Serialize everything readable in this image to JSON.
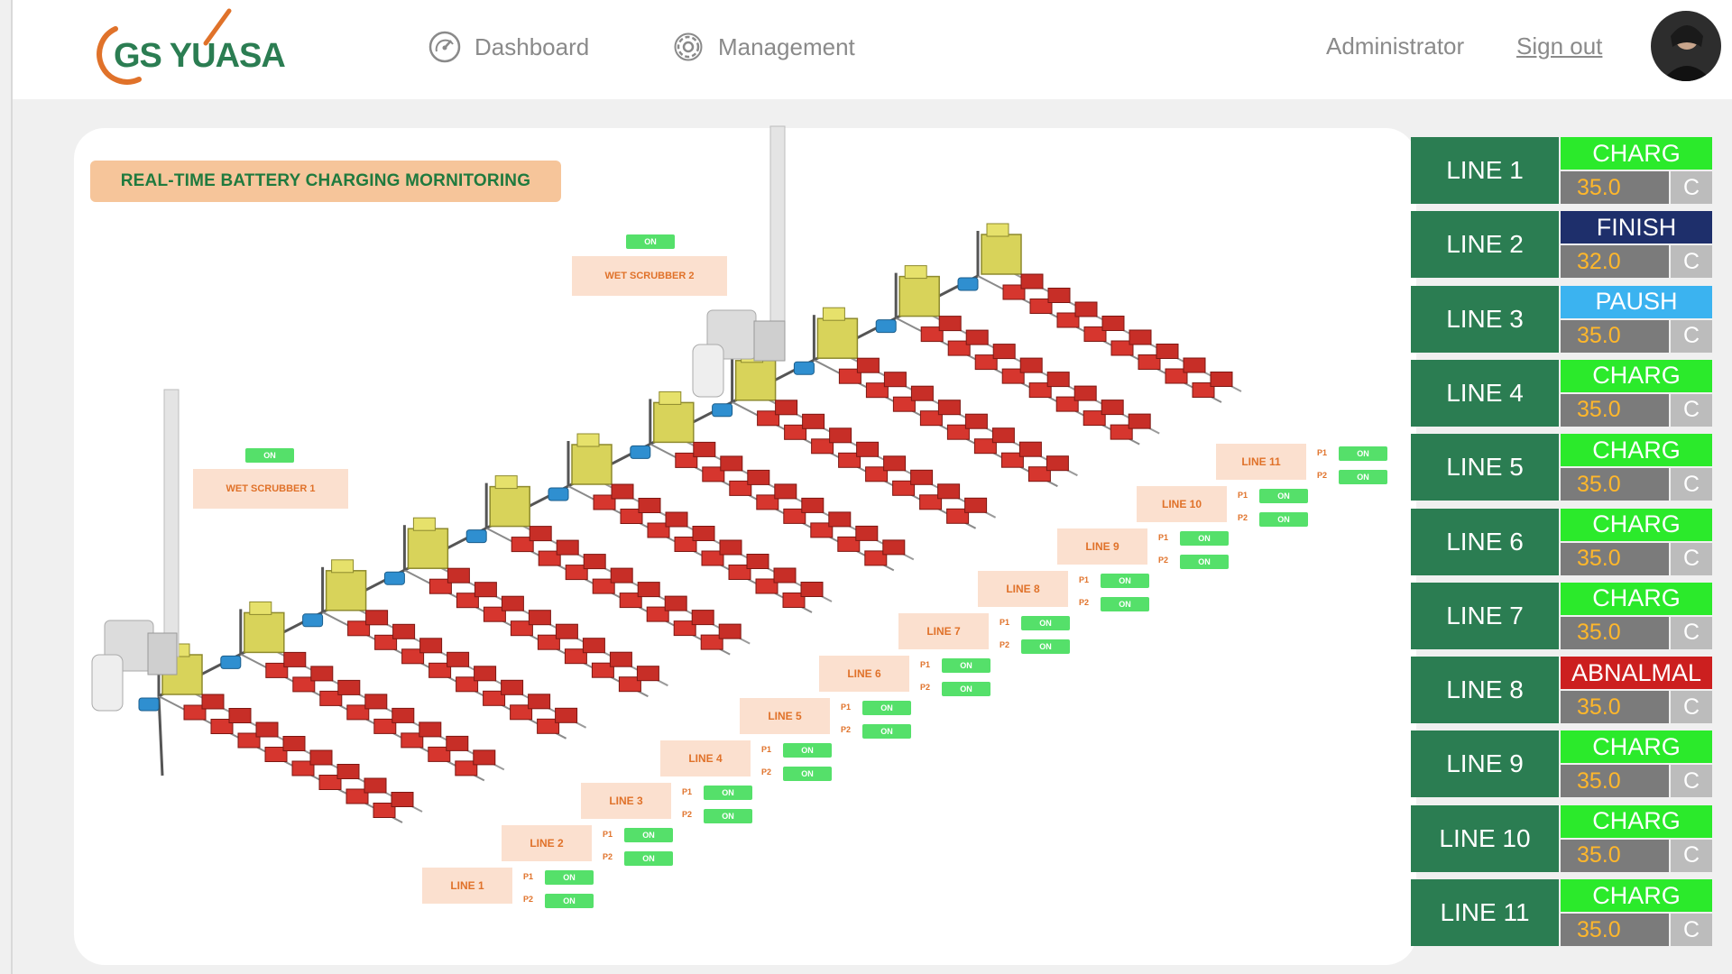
{
  "brand": {
    "logo_text": "GS YUASA",
    "colors": {
      "green": "#2b7d52",
      "orange": "#e0722a"
    }
  },
  "nav": [
    {
      "label": "Dashboard",
      "icon": "gauge-icon"
    },
    {
      "label": "Management",
      "icon": "gear-icon"
    }
  ],
  "user": {
    "name": "Administrator",
    "signout_label": "Sign out"
  },
  "panel": {
    "title": "REAL-TIME BATTERY CHARGING MORNITORING"
  },
  "scrubbers": [
    {
      "label": "WET SCRUBBER 1",
      "status": "ON"
    },
    {
      "label": "WET SCRUBBER 2",
      "status": "ON"
    }
  ],
  "lines_map": [
    {
      "label": "LINE 1",
      "p1_label": "P1",
      "p1_status": "ON",
      "p2_label": "P2",
      "p2_status": "ON"
    },
    {
      "label": "LINE 2",
      "p1_label": "P1",
      "p1_status": "ON",
      "p2_label": "P2",
      "p2_status": "ON"
    },
    {
      "label": "LINE 3",
      "p1_label": "P1",
      "p1_status": "ON",
      "p2_label": "P2",
      "p2_status": "ON"
    },
    {
      "label": "LINE 4",
      "p1_label": "P1",
      "p1_status": "ON",
      "p2_label": "P2",
      "p2_status": "ON"
    },
    {
      "label": "LINE 5",
      "p1_label": "P1",
      "p1_status": "ON",
      "p2_label": "P2",
      "p2_status": "ON"
    },
    {
      "label": "LINE 6",
      "p1_label": "P1",
      "p1_status": "ON",
      "p2_label": "P2",
      "p2_status": "ON"
    },
    {
      "label": "LINE 7",
      "p1_label": "P1",
      "p1_status": "ON",
      "p2_label": "P2",
      "p2_status": "ON"
    },
    {
      "label": "LINE 8",
      "p1_label": "P1",
      "p1_status": "ON",
      "p2_label": "P2",
      "p2_status": "ON"
    },
    {
      "label": "LINE 9",
      "p1_label": "P1",
      "p1_status": "ON",
      "p2_label": "P2",
      "p2_status": "ON"
    },
    {
      "label": "LINE 10",
      "p1_label": "P1",
      "p1_status": "ON",
      "p2_label": "P2",
      "p2_status": "ON"
    },
    {
      "label": "LINE 11",
      "p1_label": "P1",
      "p1_status": "ON",
      "p2_label": "P2",
      "p2_status": "ON"
    }
  ],
  "status_lines": [
    {
      "name": "LINE 1",
      "state": "CHARG",
      "state_color": "#2bea2b",
      "value": "35.0",
      "unit": "C"
    },
    {
      "name": "LINE 2",
      "state": "FINISH",
      "state_color": "#1e2f6b",
      "value": "32.0",
      "unit": "C"
    },
    {
      "name": "LINE 3",
      "state": "PAUSH",
      "state_color": "#3bb3f0",
      "value": "35.0",
      "unit": "C"
    },
    {
      "name": "LINE 4",
      "state": "CHARG",
      "state_color": "#2bea2b",
      "value": "35.0",
      "unit": "C"
    },
    {
      "name": "LINE 5",
      "state": "CHARG",
      "state_color": "#2bea2b",
      "value": "35.0",
      "unit": "C"
    },
    {
      "name": "LINE 6",
      "state": "CHARG",
      "state_color": "#2bea2b",
      "value": "35.0",
      "unit": "C"
    },
    {
      "name": "LINE 7",
      "state": "CHARG",
      "state_color": "#2bea2b",
      "value": "35.0",
      "unit": "C"
    },
    {
      "name": "LINE 8",
      "state": "ABNALMAL",
      "state_color": "#cc1f1f",
      "value": "35.0",
      "unit": "C"
    },
    {
      "name": "LINE 9",
      "state": "CHARG",
      "state_color": "#2bea2b",
      "value": "35.0",
      "unit": "C"
    },
    {
      "name": "LINE 10",
      "state": "CHARG",
      "state_color": "#2bea2b",
      "value": "35.0",
      "unit": "C"
    },
    {
      "name": "LINE 11",
      "state": "CHARG",
      "state_color": "#2bea2b",
      "value": "35.0",
      "unit": "C"
    }
  ]
}
